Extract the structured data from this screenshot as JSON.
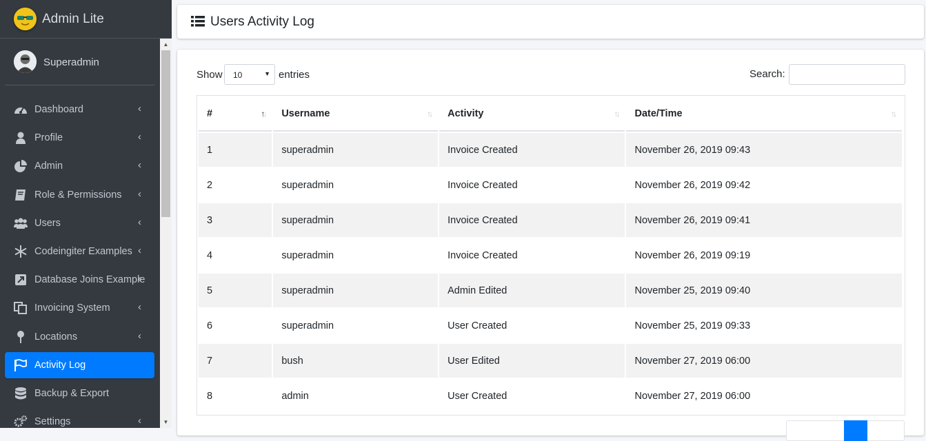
{
  "brand": {
    "name": "Admin Lite"
  },
  "user": {
    "name": "Superadmin"
  },
  "sidebar": {
    "items": [
      {
        "label": "Dashboard",
        "icon": "dashboard-icon"
      },
      {
        "label": "Profile",
        "icon": "user-icon"
      },
      {
        "label": "Admin",
        "icon": "pie-chart-icon"
      },
      {
        "label": "Role & Permissions",
        "icon": "book-icon"
      },
      {
        "label": "Users",
        "icon": "users-icon"
      },
      {
        "label": "Codeingiter Examples",
        "icon": "snowflake-icon"
      },
      {
        "label": "Database Joins Example",
        "icon": "external-link-icon"
      },
      {
        "label": "Invoicing System",
        "icon": "copy-icon"
      },
      {
        "label": "Locations",
        "icon": "map-pin-icon"
      },
      {
        "label": "Activity Log",
        "icon": "flag-icon",
        "active": true
      },
      {
        "label": "Backup & Export",
        "icon": "database-icon"
      },
      {
        "label": "Settings",
        "icon": "cogs-icon"
      }
    ]
  },
  "header": {
    "title": "Users Activity Log",
    "icon": "list-icon"
  },
  "controls": {
    "show_label": "Show",
    "length_value": "10",
    "entries_label": "entries",
    "search_label": "Search:",
    "search_value": ""
  },
  "table": {
    "columns": [
      "#",
      "Username",
      "Activity",
      "Date/Time"
    ],
    "rows": [
      [
        "1",
        "superadmin",
        "Invoice Created",
        "November 26, 2019 09:43"
      ],
      [
        "2",
        "superadmin",
        "Invoice Created",
        "November 26, 2019 09:42"
      ],
      [
        "3",
        "superadmin",
        "Invoice Created",
        "November 26, 2019 09:41"
      ],
      [
        "4",
        "superadmin",
        "Invoice Created",
        "November 26, 2019 09:19"
      ],
      [
        "5",
        "superadmin",
        "Admin Edited",
        "November 25, 2019 09:40"
      ],
      [
        "6",
        "superadmin",
        "User Created",
        "November 25, 2019 09:33"
      ],
      [
        "7",
        "bush",
        "User Edited",
        "November 27, 2019 06:00"
      ],
      [
        "8",
        "admin",
        "User Created",
        "November 27, 2019 06:00"
      ]
    ]
  },
  "colors": {
    "sidebar_bg": "#343a40",
    "active_item": "#007bff",
    "stripe": "#f2f2f2"
  }
}
